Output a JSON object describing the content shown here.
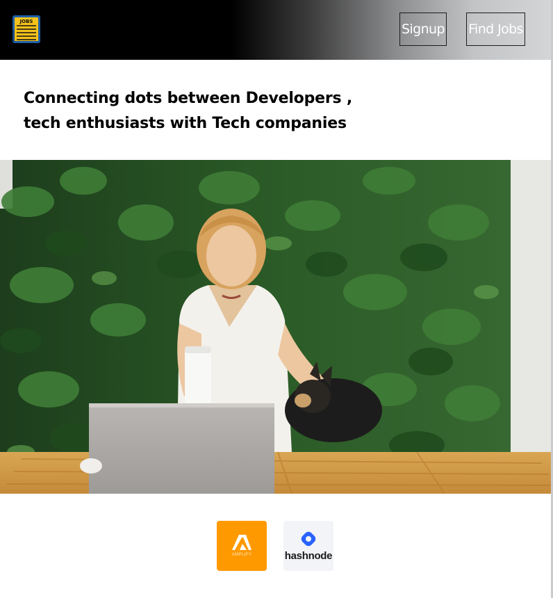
{
  "header": {
    "logo_text": "JOBS",
    "nav": {
      "signup_label": "Signup",
      "find_jobs_label": "Find Jobs"
    }
  },
  "hero": {
    "heading_line1": "Connecting dots between Developers ,",
    "heading_line2": "tech enthusiasts with Tech companies"
  },
  "sponsors": {
    "amplify_label": "AMPLIFY",
    "hashnode_label": "hashnode"
  },
  "colors": {
    "logo_blue": "#1f5fa8",
    "logo_yellow": "#f3c21b",
    "amplify_orange": "#ff9900",
    "hashnode_blue": "#2962ff"
  },
  "icons": {
    "logo": "jobs-newspaper-icon",
    "amplify": "amplify-icon",
    "hashnode": "hashnode-icon"
  }
}
